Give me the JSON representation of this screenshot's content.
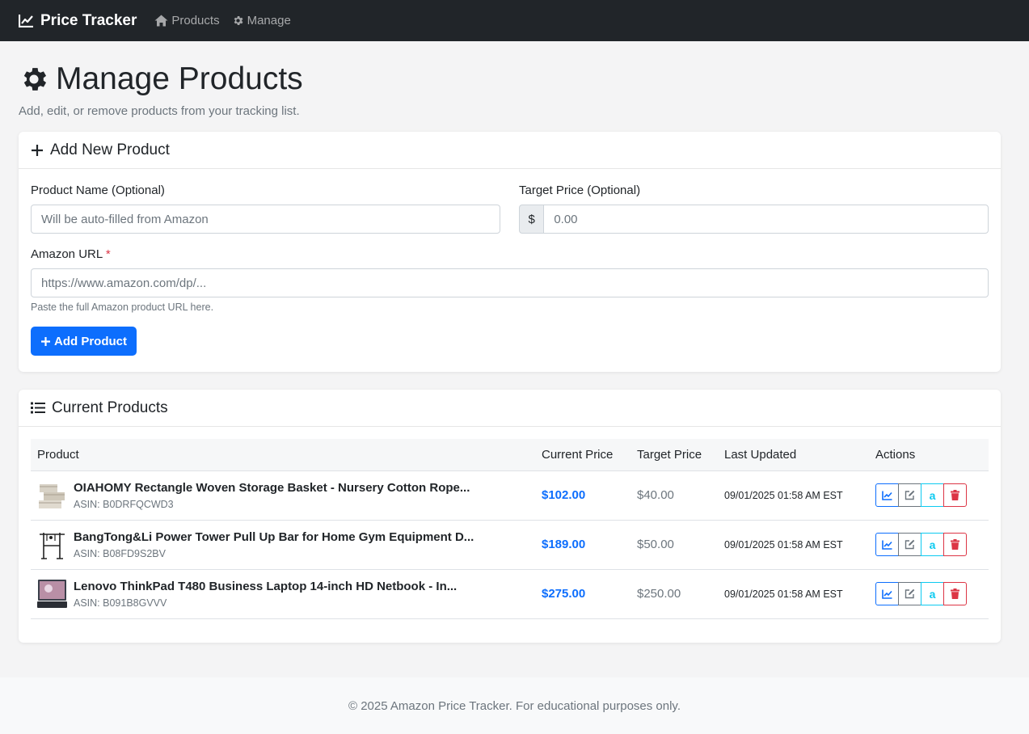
{
  "nav": {
    "brand": "Price Tracker",
    "links": [
      {
        "label": "Products",
        "icon": "home-icon"
      },
      {
        "label": "Manage",
        "icon": "gear-icon"
      }
    ]
  },
  "page": {
    "title": "Manage Products",
    "subtitle": "Add, edit, or remove products from your tracking list."
  },
  "add_form": {
    "header": "Add New Product",
    "product_name_label": "Product Name (Optional)",
    "product_name_placeholder": "Will be auto-filled from Amazon",
    "target_price_label": "Target Price (Optional)",
    "currency_symbol": "$",
    "target_price_placeholder": "0.00",
    "url_label": "Amazon URL",
    "required_marker": "*",
    "url_placeholder": "https://www.amazon.com/dp/...",
    "url_help": "Paste the full Amazon product URL here.",
    "submit_label": "Add Product"
  },
  "products_table": {
    "header": "Current Products",
    "columns": [
      "Product",
      "Current Price",
      "Target Price",
      "Last Updated",
      "Actions"
    ],
    "rows": [
      {
        "name": "OIAHOMY Rectangle Woven Storage Basket - Nursery Cotton Rope...",
        "asin": "ASIN: B0DRFQCWD3",
        "current_price": "$102.00",
        "target_price": "$40.00",
        "updated": "09/01/2025 01:58 AM EST"
      },
      {
        "name": "BangTong&Li Power Tower Pull Up Bar for Home Gym Equipment D...",
        "asin": "ASIN: B08FD9S2BV",
        "current_price": "$189.00",
        "target_price": "$50.00",
        "updated": "09/01/2025 01:58 AM EST"
      },
      {
        "name": "Lenovo ThinkPad T480 Business Laptop 14-inch HD Netbook - In...",
        "asin": "ASIN: B091B8GVVV",
        "current_price": "$275.00",
        "target_price": "$250.00",
        "updated": "09/01/2025 01:58 AM EST"
      }
    ],
    "amazon_glyph": "a"
  },
  "footer": {
    "text": "© 2025 Amazon Price Tracker. For educational purposes only."
  },
  "colors": {
    "primary": "#0d6efd",
    "danger": "#dc3545",
    "info": "#0dcaf0",
    "navbar": "#212529"
  }
}
